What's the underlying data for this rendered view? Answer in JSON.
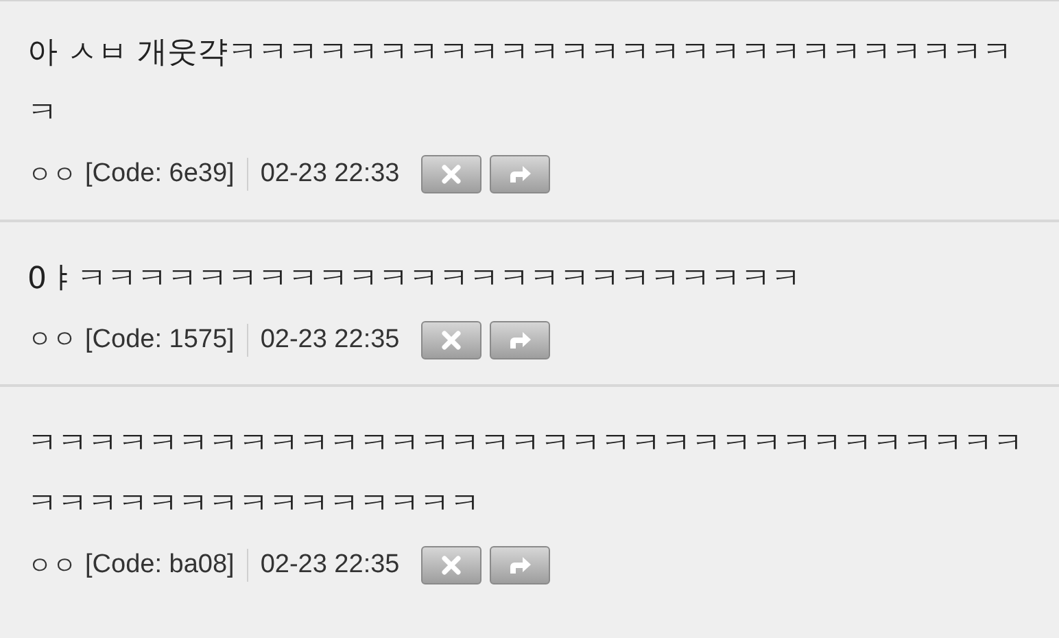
{
  "comments": [
    {
      "text": "아 ㅅㅂ 개웃갹ㅋㅋㅋㅋㅋㅋㅋㅋㅋㅋㅋㅋㅋㅋㅋㅋㅋㅋㅋㅋㅋㅋㅋㅋㅋㅋㅋ",
      "author": "ㅇㅇ",
      "code": "[Code: 6e39]",
      "time": "02-23 22:33"
    },
    {
      "text": "0ㅑㅋㅋㅋㅋㅋㅋㅋㅋㅋㅋㅋㅋㅋㅋㅋㅋㅋㅋㅋㅋㅋㅋㅋㅋ",
      "author": "ㅇㅇ",
      "code": "[Code: 1575]",
      "time": "02-23 22:35"
    },
    {
      "text": "ㅋㅋㅋㅋㅋㅋㅋㅋㅋㅋㅋㅋㅋㅋㅋㅋㅋㅋㅋㅋㅋㅋㅋㅋㅋㅋㅋㅋㅋㅋㅋㅋㅋㅋㅋㅋㅋㅋㅋㅋㅋㅋㅋㅋㅋㅋㅋㅋ",
      "author": "ㅇㅇ",
      "code": "[Code: ba08]",
      "time": "02-23 22:35"
    }
  ]
}
